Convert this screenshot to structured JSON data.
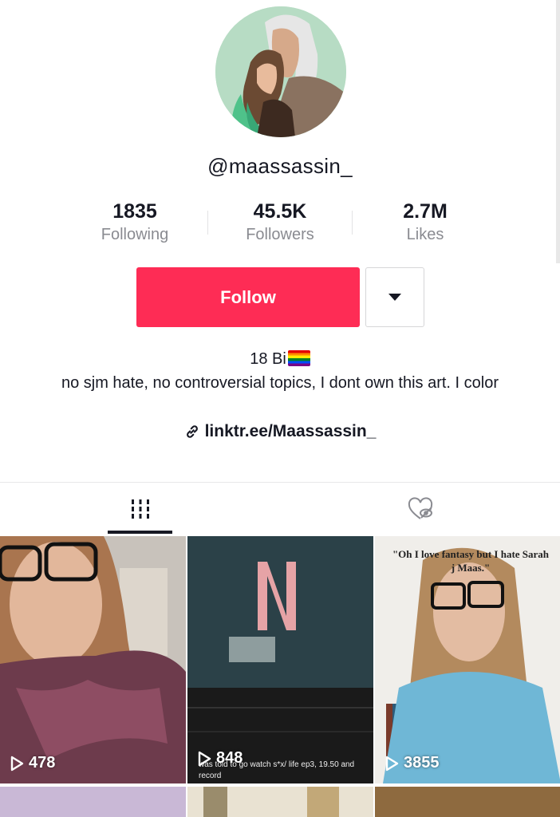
{
  "profile": {
    "username": "@maassassin_",
    "stats": [
      {
        "value": "1835",
        "label": "Following"
      },
      {
        "value": "45.5K",
        "label": "Followers"
      },
      {
        "value": "2.7M",
        "label": "Likes"
      }
    ],
    "follow_label": "Follow",
    "bio_name": "18 Bi",
    "bio_text": "no sjm hate, no controversial topics, I dont own this art. I color",
    "link": "linktr.ee/Maassassin_"
  },
  "tabs": [
    {
      "name": "videos",
      "active": true
    },
    {
      "name": "liked",
      "active": false
    }
  ],
  "videos": [
    {
      "views": "478"
    },
    {
      "views": "848",
      "caption": "was told to go watch s*x/ life ep3, 19.50 and record"
    },
    {
      "views": "3855",
      "caption": "\"Oh I love fantasy but I hate Sarah j Maas.\""
    }
  ],
  "colors": {
    "accent": "#fe2c55",
    "text": "#161823",
    "muted": "#8a8b91"
  },
  "icons": [
    "link-icon",
    "grid-icon",
    "liked-hidden-icon",
    "play-icon",
    "dropdown-arrow-icon"
  ]
}
